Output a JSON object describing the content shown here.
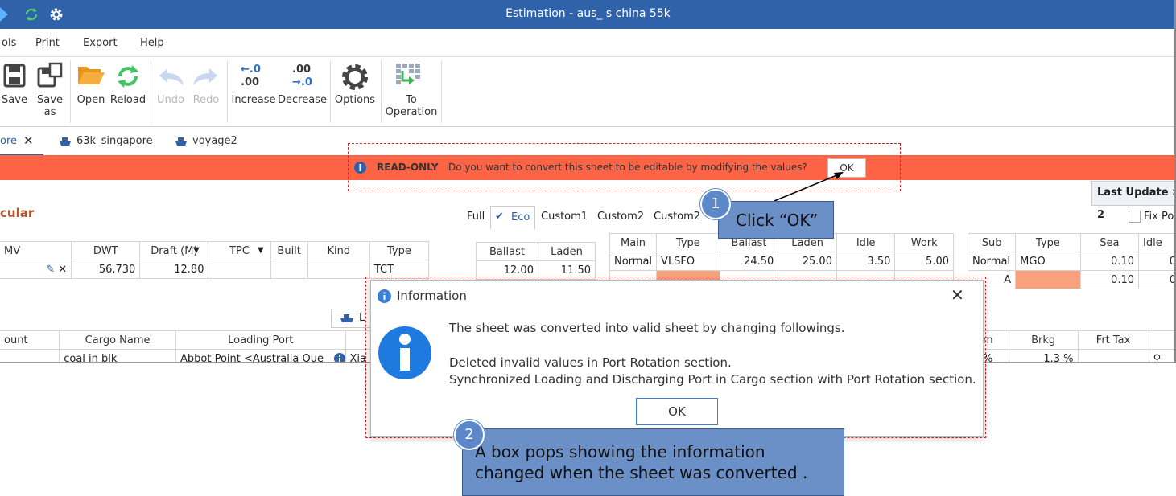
{
  "window": {
    "title": "Estimation - aus_ s china 55k"
  },
  "menu": [
    "ols",
    "Print",
    "Export",
    "Help"
  ],
  "toolbar": {
    "save": "Save",
    "save_as_1": "Save",
    "save_as_2": "as",
    "open": "Open",
    "reload": "Reload",
    "undo": "Undo",
    "redo": "Redo",
    "increase": "Increase",
    "decrease": "Decrease",
    "options": "Options",
    "to_op_1": "To",
    "to_op_2": "Operation",
    "inc_top": "←.0",
    "inc_bot": ".00",
    "dec_top": ".00",
    "dec_bot": "→.0"
  },
  "tabs": [
    "ore",
    "63k_singapore",
    "voyage2"
  ],
  "banner": {
    "label": "READ-ONLY",
    "message": "Do you want to convert this sheet to be editable by modifying the values?",
    "ok": "OK"
  },
  "last_update": "Last Update : 2",
  "section_title": "cular",
  "speed_tabs": [
    "Full",
    "Eco",
    "Custom1",
    "Custom2",
    "Custom2"
  ],
  "fix_label": "Fix Po",
  "vessel_table": {
    "headers": [
      "MV",
      "DWT",
      "Draft (M)",
      "TPC",
      "Built",
      "Kind",
      "Type"
    ],
    "row": {
      "dwt": "56,730",
      "draft": "12.80",
      "type": "TCT"
    }
  },
  "speed_table": {
    "headers": [
      "Ballast",
      "Laden"
    ],
    "row": [
      "12.00",
      "11.50"
    ]
  },
  "main_table": {
    "headers": [
      "Main",
      "Type",
      "Ballast",
      "Laden",
      "Idle",
      "Work"
    ],
    "row": [
      "Normal",
      "VLSFO",
      "24.50",
      "25.00",
      "3.50",
      "5.00"
    ]
  },
  "sub_table": {
    "headers": [
      "Sub",
      "Type",
      "Sea",
      "Idle"
    ],
    "row1": [
      "Normal",
      "MGO",
      "0.10",
      "0"
    ],
    "row2": [
      "A",
      "",
      "0.10",
      "0"
    ]
  },
  "cargo_table": {
    "headers": [
      "ount",
      "Cargo Name",
      "Loading Port"
    ],
    "row": [
      "",
      "coal in blk",
      "Abbot Point <Australia Que",
      "Xia"
    ]
  },
  "right_table": {
    "headers": [
      "m",
      "Brkg",
      "Frt Tax"
    ],
    "row": [
      "%",
      "1.3 %",
      ""
    ]
  },
  "l_button": "L",
  "dialog": {
    "title": "Information",
    "line1": "The sheet was converted into valid sheet by changing followings.",
    "line2": "Deleted invalid values in Port Rotation section.",
    "line3": "Synchronized Loading and Discharging Port in Cargo section with Port Rotation section.",
    "ok": "OK"
  },
  "callout1": {
    "num": "1",
    "text": "Click “OK”"
  },
  "callout2": {
    "num": "2",
    "line1": "A  box pops  showing the information",
    "line2": "changed  when the sheet was converted ."
  },
  "colors": {
    "titlebar": "#2f62a9",
    "banner": "#fd6345",
    "callout": "#6b8fc7",
    "dash": "#d81e1e"
  }
}
